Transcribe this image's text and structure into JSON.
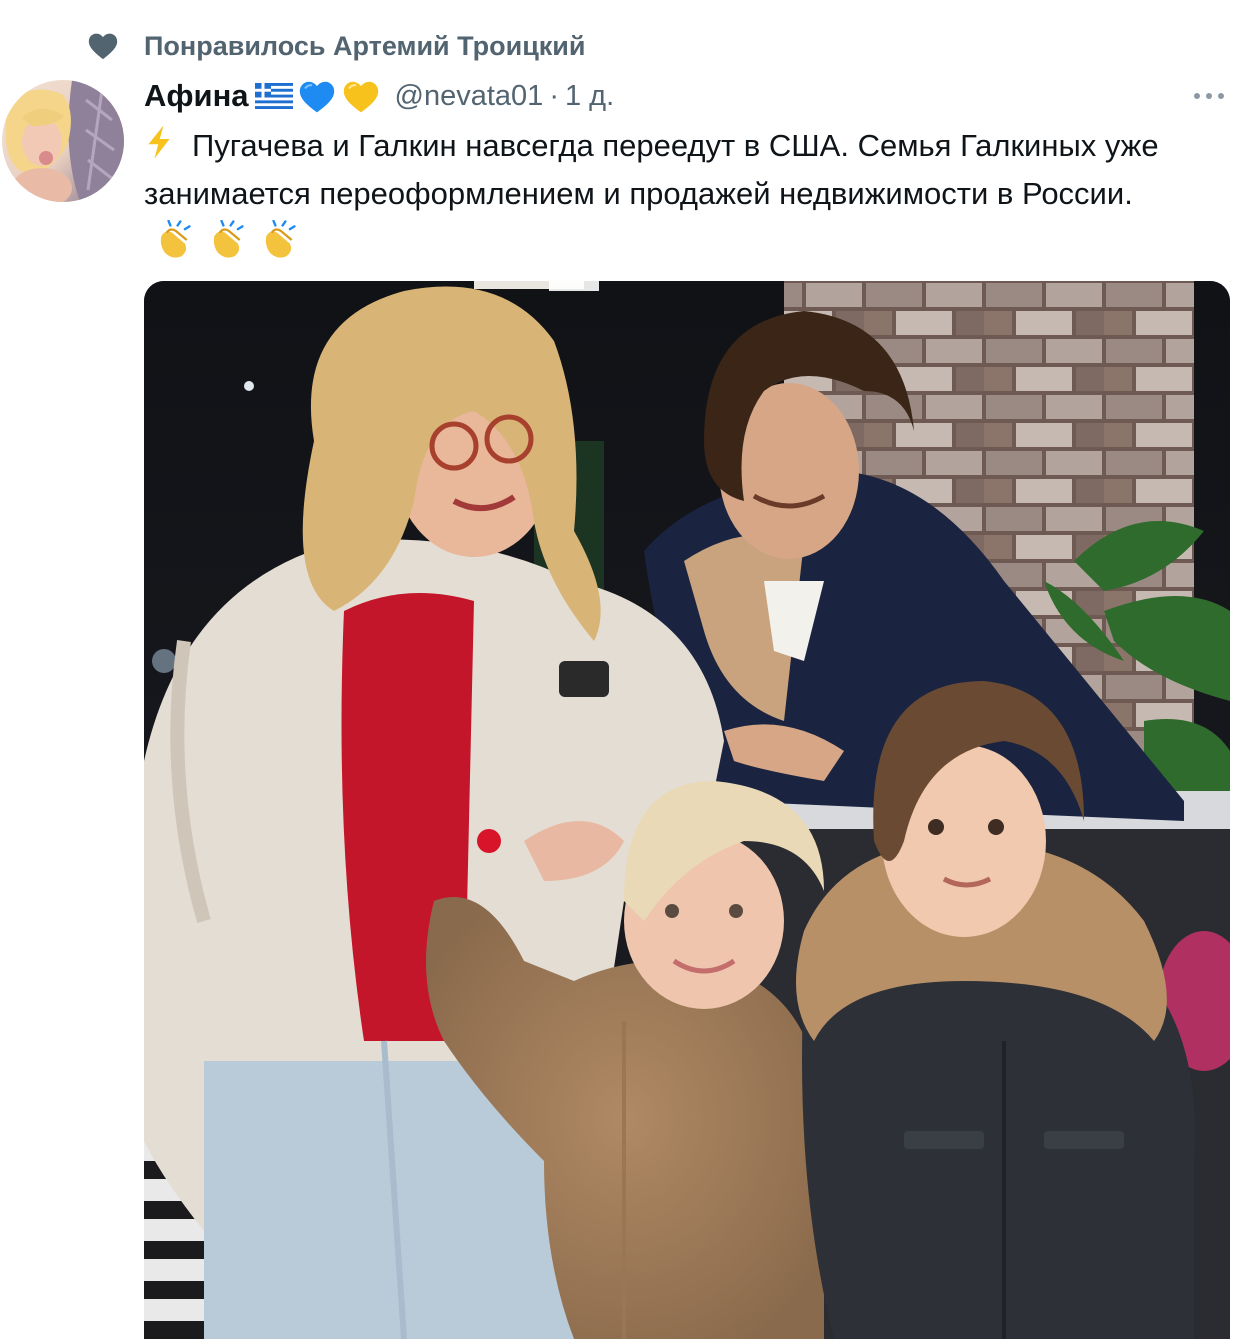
{
  "liked_by": {
    "text": "Понравилось Артемий Троицкий",
    "icon": "heart-icon"
  },
  "tweet": {
    "author_name": "Афина",
    "author_emojis": [
      "greek-flag-icon",
      "blue-heart-icon",
      "yellow-heart-icon"
    ],
    "handle": "@nevata01",
    "separator": "·",
    "time": "1 д.",
    "text": "Пугачева и Галкин навсегда переедут в США. Семья Галкиных уже занимается переоформлением и продажей недвижимости в России.",
    "leading_icon": "lightning-icon",
    "trailing_icons": [
      "clapping-hands-icon",
      "clapping-hands-icon",
      "clapping-hands-icon"
    ],
    "more_icon": "more-dots-icon"
  },
  "colors": {
    "secondary_text": "#536471",
    "primary_text": "#0f1419",
    "heart": "#536471"
  }
}
